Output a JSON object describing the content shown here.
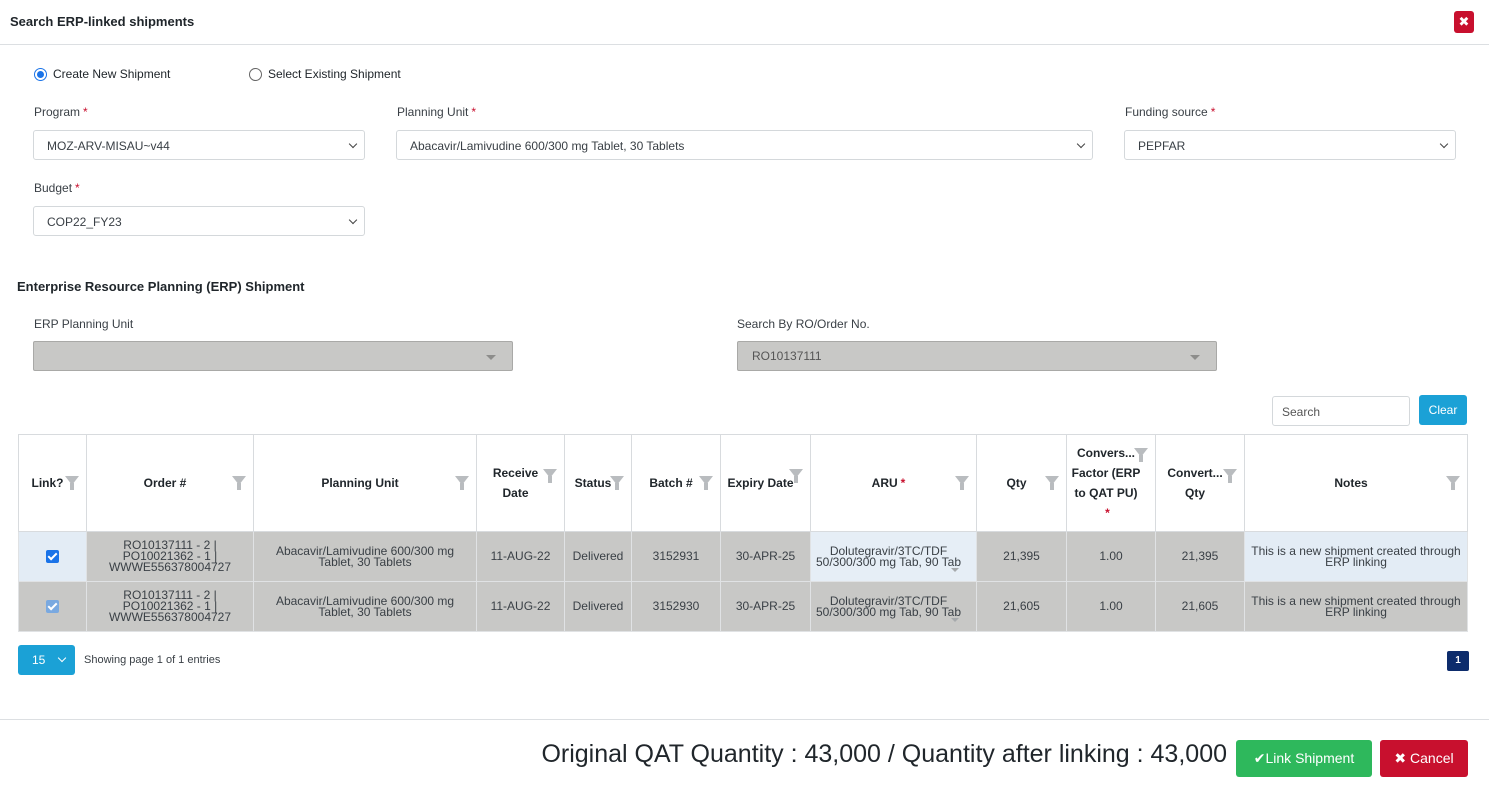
{
  "modal": {
    "title": "Search ERP-linked shipments",
    "close_icon": "✖"
  },
  "mode": {
    "options": [
      {
        "label": "Create New Shipment",
        "checked": true
      },
      {
        "label": "Select Existing Shipment",
        "checked": false
      }
    ]
  },
  "form": {
    "program": {
      "label": "Program",
      "value": "MOZ-ARV-MISAU~v44"
    },
    "planning_unit": {
      "label": "Planning Unit",
      "value": "Abacavir/Lamivudine 600/300 mg Tablet, 30 Tablets"
    },
    "funding_source": {
      "label": "Funding source",
      "value": "PEPFAR"
    },
    "budget": {
      "label": "Budget",
      "value": "COP22_FY23"
    },
    "required_mark": "*"
  },
  "erp": {
    "section_title": "Enterprise Resource Planning (ERP) Shipment",
    "planning_unit": {
      "label": "ERP Planning Unit",
      "value": ""
    },
    "order_search": {
      "label": "Search By RO/Order No.",
      "value": "RO10137111"
    }
  },
  "table_tools": {
    "search_placeholder": "Search",
    "clear_label": "Clear"
  },
  "table": {
    "headers": {
      "link": "Link?",
      "order": "Order #",
      "planning_unit": "Planning Unit",
      "receive_date": "Receive Date",
      "status": "Status",
      "batch": "Batch #",
      "expiry_date": "Expiry Date",
      "aru": "ARU",
      "qty": "Qty",
      "conversion_factor": "Convers... Factor (ERP to QAT PU)",
      "converted_qty": "Convert... Qty",
      "notes": "Notes"
    },
    "rows": [
      {
        "checked": true,
        "order": "RO10137111 - 2 | PO10021362 - 1 | WWWE556378004727",
        "planning_unit": "Abacavir/Lamivudine 600/300 mg Tablet, 30 Tablets",
        "receive_date": "11-AUG-22",
        "status": "Delivered",
        "batch": "3152931",
        "expiry_date": "30-APR-25",
        "aru": "Dolutegravir/3TC/TDF 50/300/300 mg Tab, 90 Tab",
        "qty": "21,395",
        "conversion_factor": "1.00",
        "converted_qty": "21,395",
        "notes": "This is a new shipment created through ERP linking"
      },
      {
        "checked": true,
        "order": "RO10137111 - 2 | PO10021362 - 1 | WWWE556378004727",
        "planning_unit": "Abacavir/Lamivudine 600/300 mg Tablet, 30 Tablets",
        "receive_date": "11-AUG-22",
        "status": "Delivered",
        "batch": "3152930",
        "expiry_date": "30-APR-25",
        "aru": "Dolutegravir/3TC/TDF 50/300/300 mg Tab, 90 Tab",
        "qty": "21,605",
        "conversion_factor": "1.00",
        "converted_qty": "21,605",
        "notes": "This is a new shipment created through ERP linking"
      }
    ]
  },
  "pagination": {
    "page_size": "15",
    "showing": "Showing page 1 of 1 entries",
    "current_page": "1"
  },
  "footer": {
    "quantity_text": "Original QAT Quantity : 43,000 / Quantity after linking : 43,000",
    "link_label": "Link Shipment",
    "link_icon": "✔",
    "cancel_label": "Cancel",
    "cancel_icon": "✖"
  },
  "colors": {
    "accent": "#1ba1d6",
    "danger": "#c8102e",
    "success": "#2eb85c",
    "disabled_row": "#c8c8c6"
  }
}
